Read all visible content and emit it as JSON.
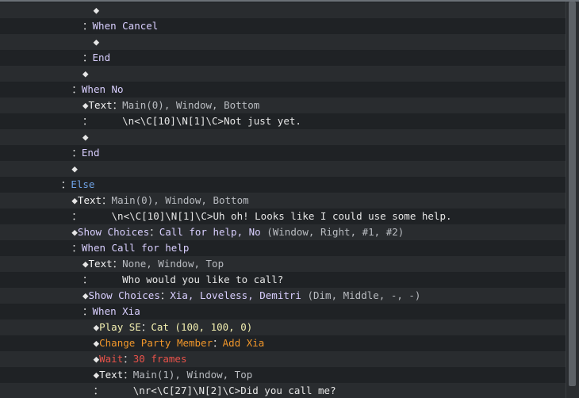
{
  "rows": [
    {
      "indent": 11,
      "parts": [
        {
          "t": "◆",
          "c": "diamond"
        }
      ]
    },
    {
      "indent": 10,
      "parts": [
        {
          "t": "：",
          "c": "sep"
        },
        {
          "t": "When Cancel",
          "c": "k-lav"
        }
      ]
    },
    {
      "indent": 11,
      "parts": [
        {
          "t": "◆",
          "c": "diamond"
        }
      ]
    },
    {
      "indent": 10,
      "parts": [
        {
          "t": "：",
          "c": "sep"
        },
        {
          "t": "End",
          "c": "k-lav"
        }
      ]
    },
    {
      "indent": 10,
      "parts": [
        {
          "t": "◆",
          "c": "diamond"
        }
      ]
    },
    {
      "indent": 9,
      "parts": [
        {
          "t": "：",
          "c": "sep"
        },
        {
          "t": "When No",
          "c": "k-lav"
        }
      ]
    },
    {
      "indent": 10,
      "parts": [
        {
          "t": "◆",
          "c": "diamond"
        },
        {
          "t": "Text",
          "c": "k-white"
        },
        {
          "t": "：",
          "c": "sep"
        },
        {
          "t": "Main(0), Window, Bottom",
          "c": "k-gray"
        }
      ]
    },
    {
      "indent": 10,
      "parts": [
        {
          "t": "：     ",
          "c": "sep"
        },
        {
          "t": "\\n<\\C[10]\\N[1]\\C>Not just yet.",
          "c": "k-default"
        }
      ]
    },
    {
      "indent": 10,
      "parts": [
        {
          "t": "◆",
          "c": "diamond"
        }
      ]
    },
    {
      "indent": 9,
      "parts": [
        {
          "t": "：",
          "c": "sep"
        },
        {
          "t": "End",
          "c": "k-lav"
        }
      ]
    },
    {
      "indent": 9,
      "parts": [
        {
          "t": "◆",
          "c": "diamond"
        }
      ]
    },
    {
      "indent": 8,
      "parts": [
        {
          "t": "：",
          "c": "sep"
        },
        {
          "t": "Else",
          "c": "k-blue"
        }
      ]
    },
    {
      "indent": 9,
      "parts": [
        {
          "t": "◆",
          "c": "diamond"
        },
        {
          "t": "Text",
          "c": "k-white"
        },
        {
          "t": "：",
          "c": "sep"
        },
        {
          "t": "Main(0), Window, Bottom",
          "c": "k-gray"
        }
      ]
    },
    {
      "indent": 9,
      "parts": [
        {
          "t": "：     ",
          "c": "sep"
        },
        {
          "t": "\\n<\\C[10]\\N[1]\\C>Uh oh! Looks like I could use some help.",
          "c": "k-default"
        }
      ]
    },
    {
      "indent": 9,
      "parts": [
        {
          "t": "◆",
          "c": "diamond"
        },
        {
          "t": "Show Choices",
          "c": "k-lav"
        },
        {
          "t": "：",
          "c": "sep"
        },
        {
          "t": "Call for help, No",
          "c": "k-lav"
        },
        {
          "t": " (Window, Right, #1, #2)",
          "c": "k-gray"
        }
      ]
    },
    {
      "indent": 9,
      "parts": [
        {
          "t": "：",
          "c": "sep"
        },
        {
          "t": "When Call for help",
          "c": "k-lav"
        }
      ]
    },
    {
      "indent": 10,
      "parts": [
        {
          "t": "◆",
          "c": "diamond"
        },
        {
          "t": "Text",
          "c": "k-white"
        },
        {
          "t": "：",
          "c": "sep"
        },
        {
          "t": "None, Window, Top",
          "c": "k-gray"
        }
      ]
    },
    {
      "indent": 10,
      "parts": [
        {
          "t": "：     ",
          "c": "sep"
        },
        {
          "t": "Who would you like to call?",
          "c": "k-default"
        }
      ]
    },
    {
      "indent": 10,
      "parts": [
        {
          "t": "◆",
          "c": "diamond"
        },
        {
          "t": "Show Choices",
          "c": "k-lav"
        },
        {
          "t": "：",
          "c": "sep"
        },
        {
          "t": "Xia, Loveless, Demitri",
          "c": "k-lav"
        },
        {
          "t": " (Dim, Middle, -, -)",
          "c": "k-gray"
        }
      ]
    },
    {
      "indent": 10,
      "parts": [
        {
          "t": "：",
          "c": "sep"
        },
        {
          "t": "When Xia",
          "c": "k-lav"
        }
      ]
    },
    {
      "indent": 11,
      "parts": [
        {
          "t": "◆",
          "c": "diamond"
        },
        {
          "t": "Play SE",
          "c": "k-yellow"
        },
        {
          "t": "：",
          "c": "sep"
        },
        {
          "t": "Cat (100, 100, 0)",
          "c": "k-yellow"
        }
      ]
    },
    {
      "indent": 11,
      "parts": [
        {
          "t": "◆",
          "c": "diamond"
        },
        {
          "t": "Change Party Member",
          "c": "k-orange"
        },
        {
          "t": "：",
          "c": "sep"
        },
        {
          "t": "Add Xia",
          "c": "k-orange"
        }
      ]
    },
    {
      "indent": 11,
      "parts": [
        {
          "t": "◆",
          "c": "diamond"
        },
        {
          "t": "Wait",
          "c": "k-red"
        },
        {
          "t": "：",
          "c": "sep"
        },
        {
          "t": "30 frames",
          "c": "k-red"
        }
      ]
    },
    {
      "indent": 11,
      "parts": [
        {
          "t": "◆",
          "c": "diamond"
        },
        {
          "t": "Text",
          "c": "k-white"
        },
        {
          "t": "：",
          "c": "sep"
        },
        {
          "t": "Main(1), Window, Top",
          "c": "k-gray"
        }
      ]
    },
    {
      "indent": 11,
      "parts": [
        {
          "t": "：     ",
          "c": "sep"
        },
        {
          "t": "\\nr<\\C[27]\\N[2]\\C>Did you call me?",
          "c": "k-default"
        }
      ]
    }
  ],
  "scroll": {
    "position": 0.0,
    "visible_fraction": 0.97
  }
}
